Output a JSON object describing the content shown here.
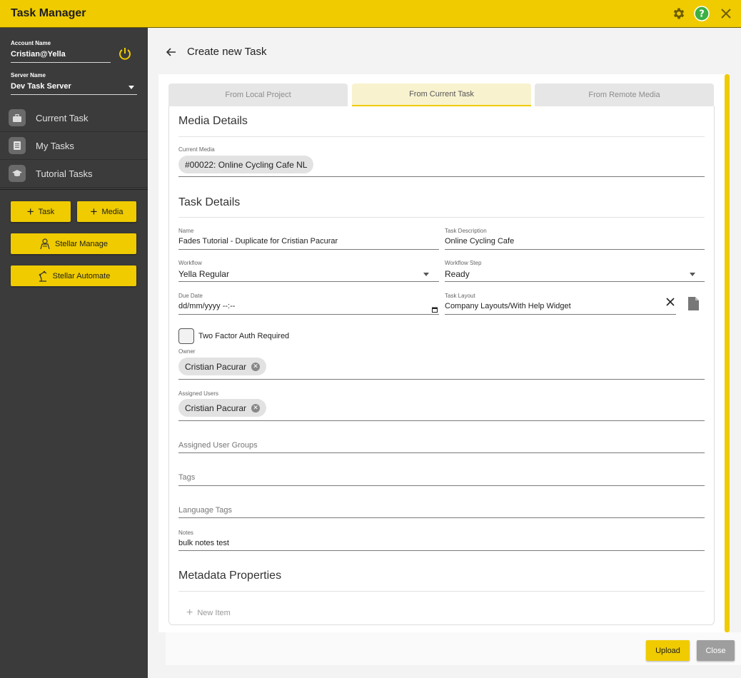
{
  "app": {
    "title": "Task Manager",
    "accent_color": "#efcb00",
    "icons": [
      "gear-icon",
      "help-icon",
      "close-icon"
    ]
  },
  "sidebar": {
    "account_label": "Account Name",
    "account_value": "Cristian@Yella",
    "server_label": "Server Name",
    "server_value": "Dev Task Server",
    "nav": [
      {
        "label": "Current Task",
        "icon": "briefcase-icon"
      },
      {
        "label": "My Tasks",
        "icon": "list-icon"
      },
      {
        "label": "Tutorial Tasks",
        "icon": "graduation-cap-icon"
      }
    ],
    "buttons": {
      "task": "Task",
      "media": "Media",
      "stellar_manage": "Stellar Manage",
      "stellar_automate": "Stellar Automate"
    }
  },
  "main": {
    "page_title": "Create new Task",
    "tabs": [
      {
        "label": "From Local Project",
        "active": false
      },
      {
        "label": "From Current Task",
        "active": true
      },
      {
        "label": "From Remote Media",
        "active": false
      }
    ],
    "media_details": {
      "title": "Media Details",
      "current_media_label": "Current Media",
      "current_media_value": "#00022: Online Cycling Cafe NL"
    },
    "task_details": {
      "title": "Task Details",
      "name_label": "Name",
      "name_value": "Fades Tutorial - Duplicate for Cristian Pacurar",
      "description_label": "Task Description",
      "description_value": "Online Cycling Cafe",
      "workflow_label": "Workflow",
      "workflow_value": "Yella Regular",
      "workflow_step_label": "Workflow Step",
      "workflow_step_value": "Ready",
      "due_date_label": "Due Date",
      "due_date_placeholder": "dd/mm/yyyy --:--",
      "task_layout_label": "Task Layout",
      "task_layout_value": "Company Layouts/With Help Widget",
      "two_factor_label": "Two Factor Auth Required",
      "two_factor_checked": false,
      "owner_label": "Owner",
      "owner_value": "Cristian Pacurar",
      "assigned_users_label": "Assigned Users",
      "assigned_users_value": "Cristian Pacurar",
      "assigned_groups_label": "Assigned User Groups",
      "tags_label": "Tags",
      "language_tags_label": "Language Tags",
      "notes_label": "Notes",
      "notes_value": "bulk notes test"
    },
    "metadata": {
      "title": "Metadata Properties",
      "new_item_label": "New Item"
    }
  },
  "footer": {
    "upload_label": "Upload",
    "close_label": "Close"
  }
}
